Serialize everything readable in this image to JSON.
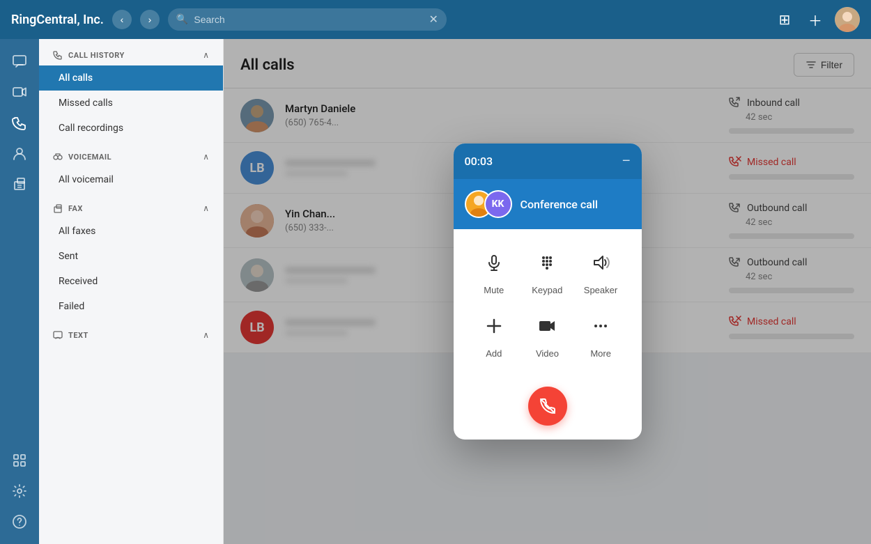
{
  "app": {
    "title": "RingCentral, Inc.",
    "search_placeholder": "Search"
  },
  "topbar": {
    "nav_back": "‹",
    "nav_forward": "›",
    "clear_search": "✕",
    "filter_label": "Filter"
  },
  "icon_sidebar": {
    "icons": [
      {
        "name": "messages-icon",
        "symbol": "💬"
      },
      {
        "name": "video-icon",
        "symbol": "📹"
      },
      {
        "name": "phone-icon",
        "symbol": "📞"
      },
      {
        "name": "contacts-icon",
        "symbol": "👤"
      },
      {
        "name": "fax-icon",
        "symbol": "📄"
      }
    ],
    "bottom_icons": [
      {
        "name": "extensions-icon",
        "symbol": "⚙"
      },
      {
        "name": "settings-icon",
        "symbol": "⚙"
      },
      {
        "name": "help-icon",
        "symbol": "?"
      }
    ]
  },
  "nav_sidebar": {
    "sections": [
      {
        "id": "call-history",
        "header": "CALL HISTORY",
        "items": [
          {
            "id": "all-calls",
            "label": "All calls",
            "active": true
          },
          {
            "id": "missed-calls",
            "label": "Missed calls",
            "active": false
          },
          {
            "id": "call-recordings",
            "label": "Call recordings",
            "active": false
          }
        ]
      },
      {
        "id": "voicemail",
        "header": "VOICEMAIL",
        "items": [
          {
            "id": "all-voicemail",
            "label": "All voicemail",
            "active": false
          }
        ]
      },
      {
        "id": "fax",
        "header": "FAX",
        "items": [
          {
            "id": "all-faxes",
            "label": "All faxes",
            "active": false
          },
          {
            "id": "sent",
            "label": "Sent",
            "active": false
          },
          {
            "id": "received",
            "label": "Received",
            "active": false
          },
          {
            "id": "failed",
            "label": "Failed",
            "active": false
          }
        ]
      },
      {
        "id": "text",
        "header": "TEXT",
        "items": []
      }
    ]
  },
  "main": {
    "title": "All calls",
    "filter_label": "Filter",
    "calls": [
      {
        "id": "call-1",
        "name": "Martyn Daniele",
        "number": "(650) 765-4...",
        "avatar_bg": "#5b8fa8",
        "avatar_text": "",
        "avatar_type": "photo",
        "call_type": "Inbound call",
        "call_type_style": "normal",
        "duration": "42 sec"
      },
      {
        "id": "call-2",
        "name": "",
        "number": "",
        "avatar_bg": "#4a90d9",
        "avatar_text": "LB",
        "avatar_type": "initials",
        "call_type": "Missed call",
        "call_type_style": "missed",
        "duration": ""
      },
      {
        "id": "call-3",
        "name": "Yin Chan...",
        "number": "(650) 333-...",
        "avatar_bg": "#c47a5a",
        "avatar_text": "",
        "avatar_type": "photo",
        "call_type": "Outbound call",
        "call_type_style": "normal",
        "duration": "42 sec"
      },
      {
        "id": "call-4",
        "name": "",
        "number": "",
        "avatar_bg": "#aaa",
        "avatar_text": "",
        "avatar_type": "photo",
        "call_type": "Outbound call",
        "call_type_style": "normal",
        "duration": "42 sec"
      },
      {
        "id": "call-5",
        "name": "",
        "number": "",
        "avatar_bg": "#e53935",
        "avatar_text": "LB",
        "avatar_type": "initials",
        "call_type": "Missed call",
        "call_type_style": "missed",
        "duration": ""
      }
    ]
  },
  "conference_modal": {
    "timer": "00:03",
    "minimize_label": "−",
    "label": "Conference call",
    "avatar1_bg": "#f5a623",
    "avatar1_text": "",
    "avatar2_bg": "#7b68ee",
    "avatar2_text": "KK",
    "controls": [
      {
        "id": "mute",
        "label": "Mute"
      },
      {
        "id": "keypad",
        "label": "Keypad"
      },
      {
        "id": "speaker",
        "label": "Speaker"
      }
    ],
    "controls2": [
      {
        "id": "add",
        "label": "Add"
      },
      {
        "id": "video",
        "label": "Video"
      },
      {
        "id": "more",
        "label": "More"
      }
    ]
  }
}
